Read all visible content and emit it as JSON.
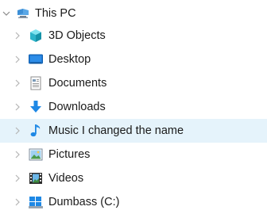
{
  "tree": {
    "root": {
      "label": "This PC",
      "expanded": true,
      "icon": "this-pc-icon"
    },
    "items": [
      {
        "label": "3D Objects",
        "icon": "3d-objects-icon"
      },
      {
        "label": "Desktop",
        "icon": "desktop-icon"
      },
      {
        "label": "Documents",
        "icon": "documents-icon"
      },
      {
        "label": "Downloads",
        "icon": "downloads-icon"
      },
      {
        "label": "Music I changed the name",
        "icon": "music-icon",
        "selected": true
      },
      {
        "label": "Pictures",
        "icon": "pictures-icon"
      },
      {
        "label": "Videos",
        "icon": "videos-icon"
      },
      {
        "label": "Dumbass (C:)",
        "icon": "drive-icon"
      }
    ]
  },
  "colors": {
    "selection_background": "#e5f3fb",
    "chevron": "#a0a0a0",
    "accent_blue": "#1e88e5"
  }
}
